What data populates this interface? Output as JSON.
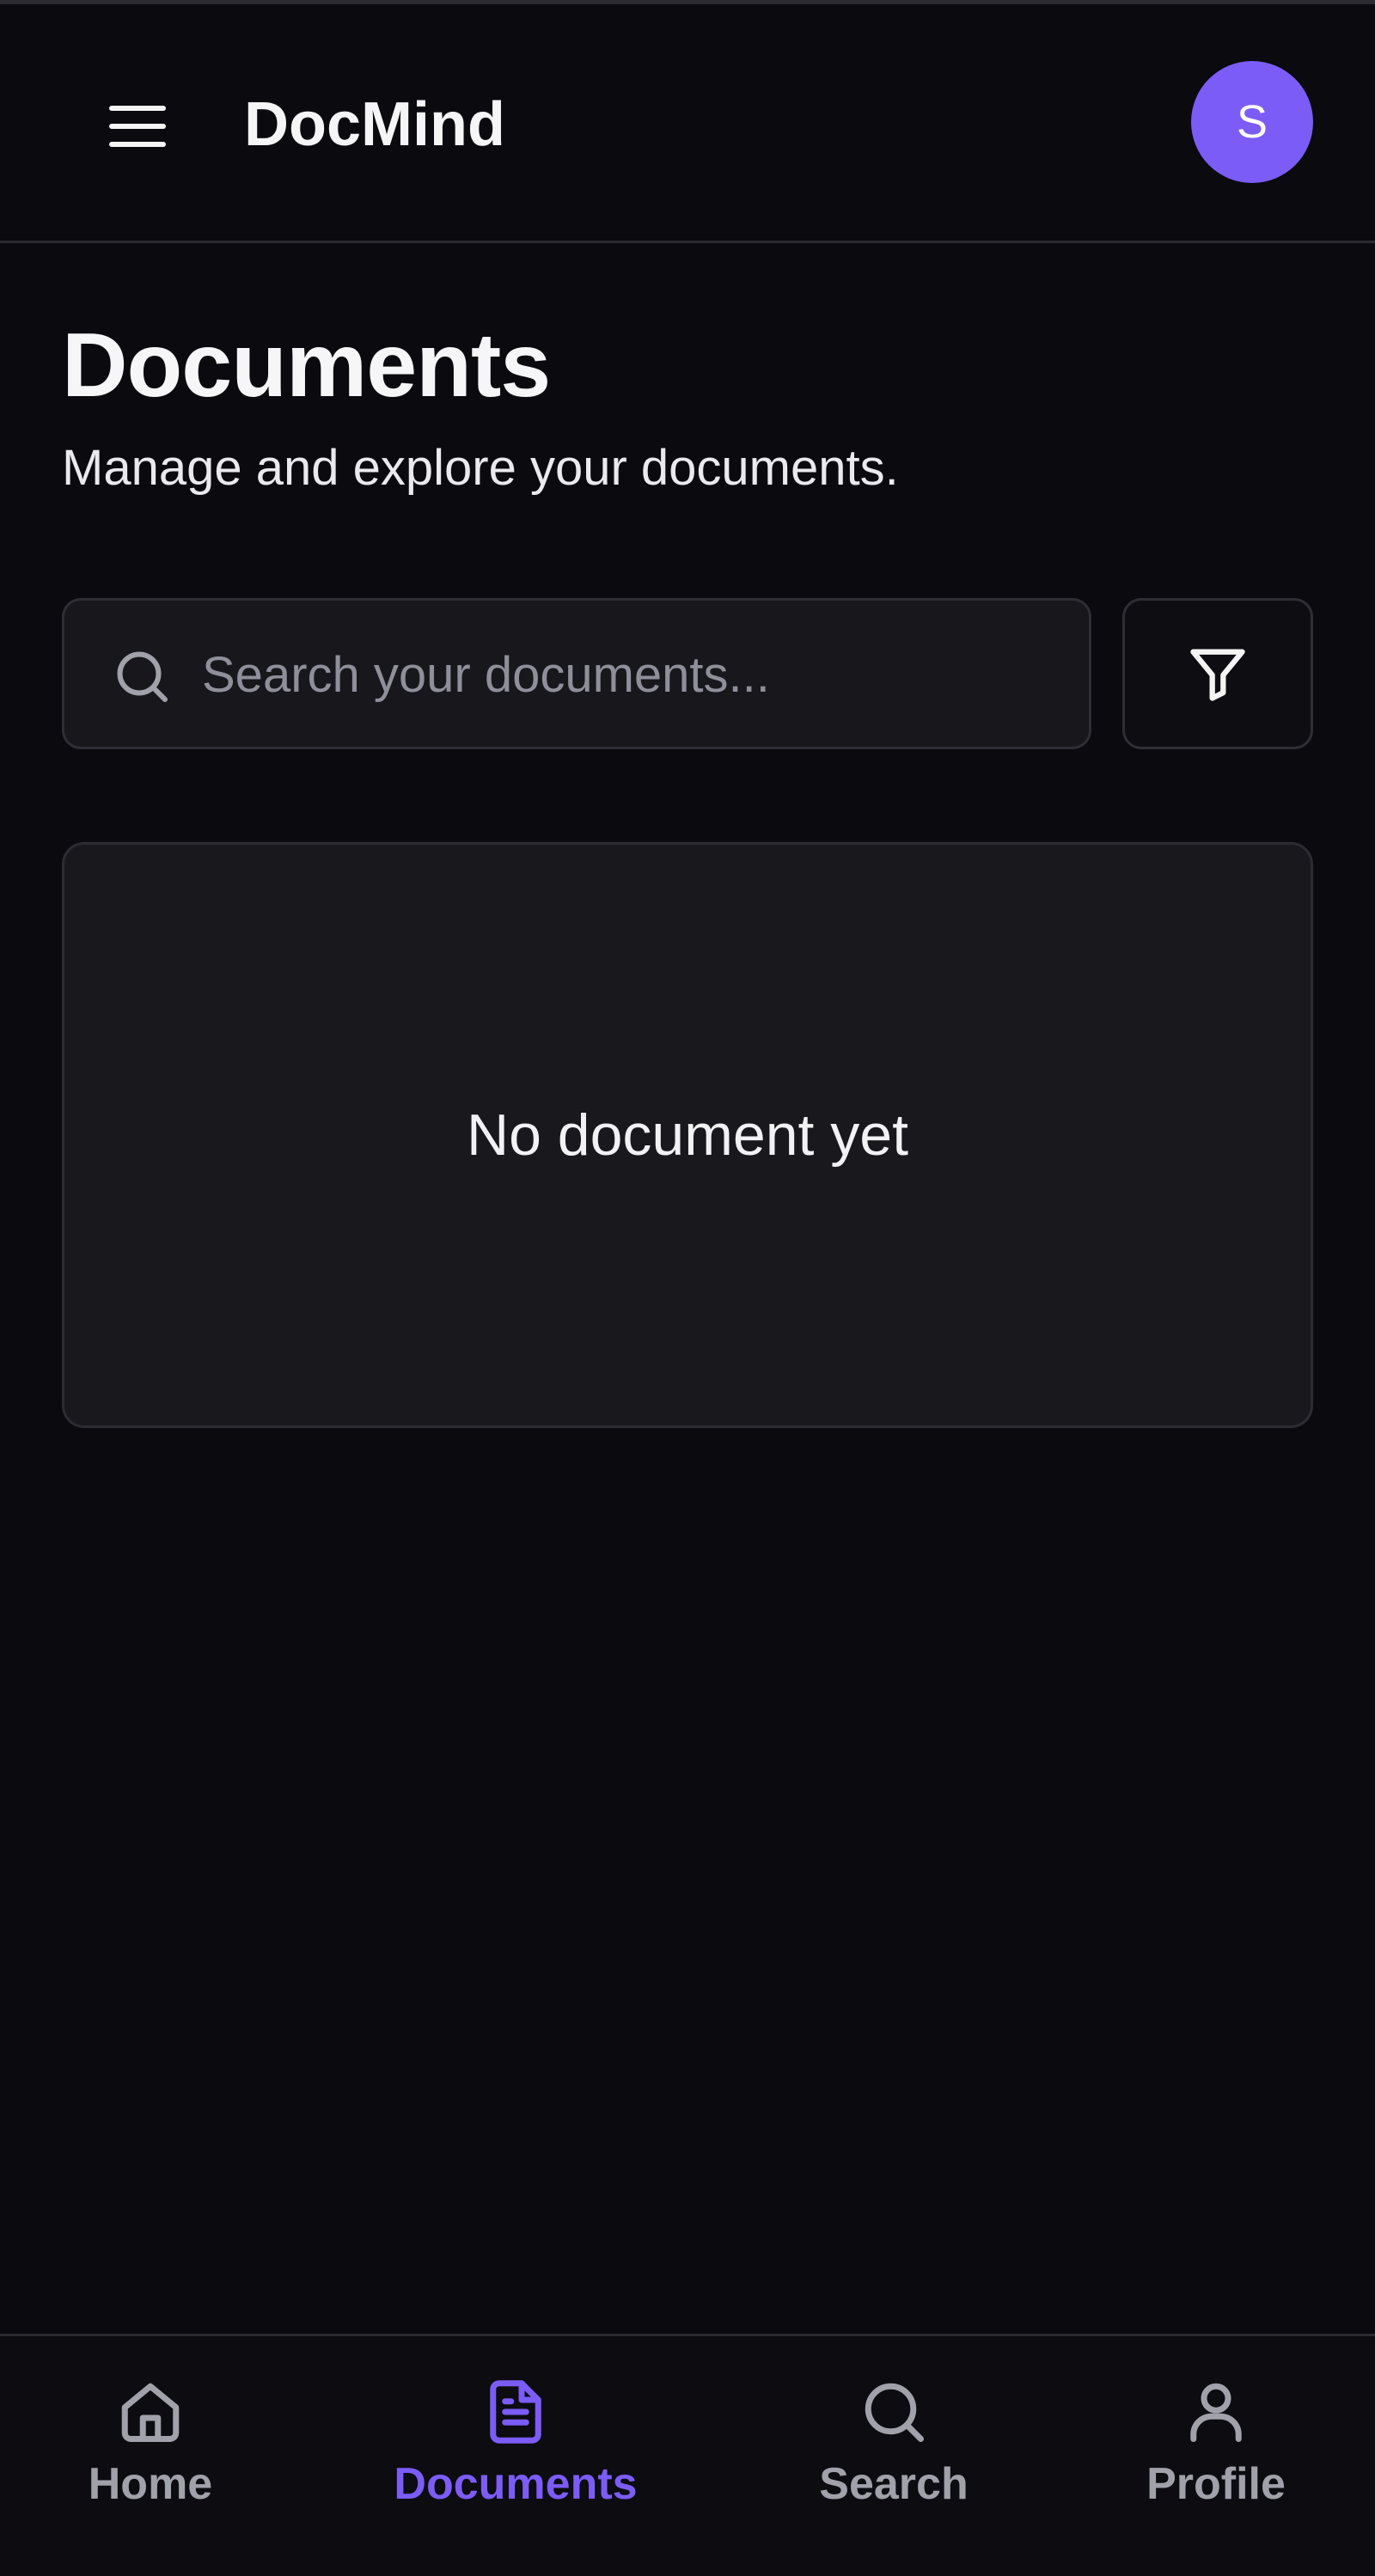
{
  "app": {
    "title": "DocMind",
    "avatar_initial": "S",
    "accent_color": "#7c5cf6",
    "background_color": "#0a0a0f"
  },
  "header": {
    "menu_icon": "hamburger-menu-icon"
  },
  "page": {
    "title": "Documents",
    "subtitle": "Manage and explore your documents."
  },
  "search": {
    "placeholder": "Search your documents...",
    "value": "",
    "icon": "search-icon"
  },
  "filter": {
    "icon": "filter-icon"
  },
  "empty_state": {
    "text": "No document yet"
  },
  "bottom_nav": {
    "items": [
      {
        "label": "Home",
        "icon": "home-icon",
        "active": false
      },
      {
        "label": "Documents",
        "icon": "document-icon",
        "active": true
      },
      {
        "label": "Search",
        "icon": "search-icon",
        "active": false
      },
      {
        "label": "Profile",
        "icon": "user-icon",
        "active": false
      }
    ]
  }
}
